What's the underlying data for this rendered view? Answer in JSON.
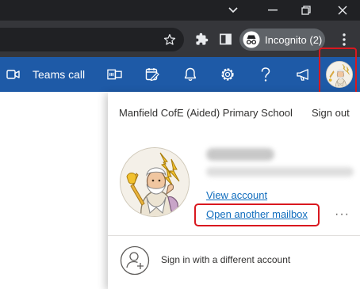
{
  "browser": {
    "incognito_label": "Incognito (2)",
    "icons": {
      "chevron": "chevron-down-icon",
      "minimize": "minimize-icon",
      "restore": "restore-icon",
      "close": "close-icon",
      "star": "star-icon",
      "extensions": "puzzle-icon",
      "side_panel": "side-panel-icon",
      "incognito": "incognito-icon",
      "menu": "kebab-menu-icon"
    }
  },
  "outlook": {
    "brand_color": "#1e5aa7",
    "teams_call_label": "Teams call",
    "header_icons": [
      "video-icon",
      "office-apps-icon",
      "tasks-icon",
      "bell-icon",
      "gear-icon",
      "help-icon",
      "megaphone-icon"
    ]
  },
  "account": {
    "organization": "Manfield CofE (Aided) Primary School",
    "sign_out_label": "Sign out",
    "display_name": "",
    "email": "",
    "view_account_label": "View account",
    "open_mailbox_label": "Open another mailbox",
    "more_label": "···",
    "sign_in_other_label": "Sign in with a different account",
    "link_color": "#0f6cbd",
    "highlight_color": "#d9181f"
  }
}
